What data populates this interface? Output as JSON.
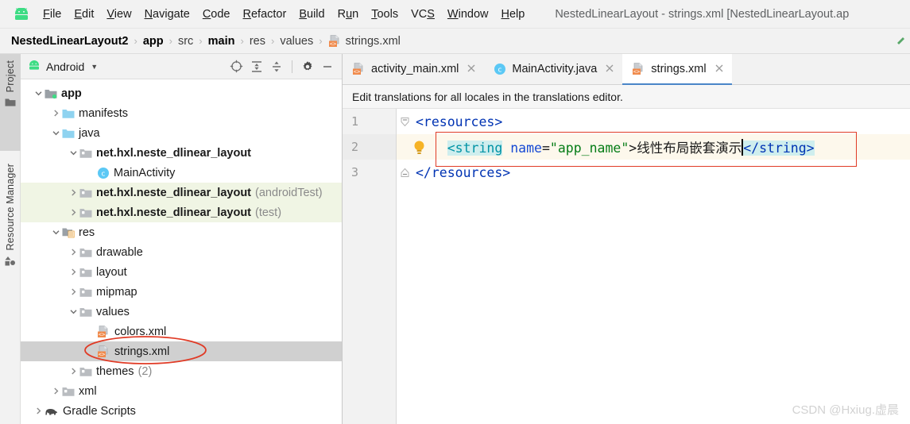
{
  "window": {
    "title": "NestedLinearLayout - strings.xml [NestedLinearLayout.ap",
    "logo_icon": "android-logo-icon"
  },
  "menubar": {
    "items": [
      {
        "label": "File",
        "mnemonic": "F"
      },
      {
        "label": "Edit",
        "mnemonic": "E"
      },
      {
        "label": "View",
        "mnemonic": "V"
      },
      {
        "label": "Navigate",
        "mnemonic": "N"
      },
      {
        "label": "Code",
        "mnemonic": "C"
      },
      {
        "label": "Refactor",
        "mnemonic": "R"
      },
      {
        "label": "Build",
        "mnemonic": "B"
      },
      {
        "label": "Run",
        "mnemonic": "u"
      },
      {
        "label": "Tools",
        "mnemonic": "T"
      },
      {
        "label": "VCS",
        "mnemonic": "S"
      },
      {
        "label": "Window",
        "mnemonic": "W"
      },
      {
        "label": "Help",
        "mnemonic": "H"
      }
    ]
  },
  "breadcrumb": {
    "items": [
      {
        "label": "NestedLinearLayout2",
        "bold": true
      },
      {
        "label": "app",
        "bold": true
      },
      {
        "label": "src",
        "bold": false
      },
      {
        "label": "main",
        "bold": true
      },
      {
        "label": "res",
        "bold": false
      },
      {
        "label": "values",
        "bold": false
      },
      {
        "label": "strings.xml",
        "bold": false,
        "icon": "xml-file-icon"
      }
    ],
    "separator": "›"
  },
  "tool_tabs": [
    {
      "label": "Project",
      "icon": "project-folder-icon",
      "active": true
    },
    {
      "label": "Resource Manager",
      "icon": "resource-manager-icon",
      "active": false
    }
  ],
  "project_panel": {
    "title": "Android",
    "title_icon": "android-head-icon",
    "dropdown_icon": "chevron-down-icon",
    "tools": [
      {
        "name": "select-opened-file-icon"
      },
      {
        "name": "expand-all-icon"
      },
      {
        "name": "collapse-all-icon"
      },
      {
        "name": "settings-gear-icon"
      },
      {
        "name": "hide-panel-icon"
      }
    ],
    "tree": [
      {
        "label": "app",
        "suffix": "",
        "depth": 0,
        "arrow": "down",
        "icon": "module-folder-icon",
        "bold": true,
        "state": "normal"
      },
      {
        "label": "manifests",
        "suffix": "",
        "depth": 1,
        "arrow": "right",
        "icon": "folder-blue-icon",
        "bold": false,
        "state": "normal"
      },
      {
        "label": "java",
        "suffix": "",
        "depth": 1,
        "arrow": "down",
        "icon": "folder-blue-icon",
        "bold": false,
        "state": "normal"
      },
      {
        "label": "net.hxl.neste_dlinear_layout",
        "suffix": "",
        "depth": 2,
        "arrow": "down",
        "icon": "package-icon",
        "bold": true,
        "state": "normal"
      },
      {
        "label": "MainActivity",
        "suffix": "",
        "depth": 3,
        "arrow": "none",
        "icon": "java-class-icon",
        "bold": false,
        "state": "normal"
      },
      {
        "label": "net.hxl.neste_dlinear_layout",
        "suffix": "(androidTest)",
        "depth": 2,
        "arrow": "right",
        "icon": "package-icon",
        "bold": true,
        "state": "test"
      },
      {
        "label": "net.hxl.neste_dlinear_layout",
        "suffix": "(test)",
        "depth": 2,
        "arrow": "right",
        "icon": "package-icon",
        "bold": true,
        "state": "test"
      },
      {
        "label": "res",
        "suffix": "",
        "depth": 1,
        "arrow": "down",
        "icon": "res-folder-icon",
        "bold": false,
        "state": "normal"
      },
      {
        "label": "drawable",
        "suffix": "",
        "depth": 2,
        "arrow": "right",
        "icon": "package-icon",
        "bold": false,
        "state": "normal"
      },
      {
        "label": "layout",
        "suffix": "",
        "depth": 2,
        "arrow": "right",
        "icon": "package-icon",
        "bold": false,
        "state": "normal"
      },
      {
        "label": "mipmap",
        "suffix": "",
        "depth": 2,
        "arrow": "right",
        "icon": "package-icon",
        "bold": false,
        "state": "normal"
      },
      {
        "label": "values",
        "suffix": "",
        "depth": 2,
        "arrow": "down",
        "icon": "package-icon",
        "bold": false,
        "state": "normal"
      },
      {
        "label": "colors.xml",
        "suffix": "",
        "depth": 3,
        "arrow": "none",
        "icon": "xml-file-icon",
        "bold": false,
        "state": "normal"
      },
      {
        "label": "strings.xml",
        "suffix": "",
        "depth": 3,
        "arrow": "none",
        "icon": "xml-file-icon",
        "bold": false,
        "state": "selected"
      },
      {
        "label": "themes",
        "suffix": "(2)",
        "depth": 2,
        "arrow": "right",
        "icon": "package-icon",
        "bold": false,
        "state": "normal"
      },
      {
        "label": "xml",
        "suffix": "",
        "depth": 1,
        "arrow": "right",
        "icon": "package-icon",
        "bold": false,
        "state": "normal"
      },
      {
        "label": "Gradle Scripts",
        "suffix": "",
        "depth": 0,
        "arrow": "right",
        "icon": "gradle-elephant-icon",
        "bold": false,
        "state": "normal"
      }
    ]
  },
  "editor": {
    "tabs": [
      {
        "label": "activity_main.xml",
        "icon": "xml-file-icon",
        "active": false,
        "close_icon": "close-icon"
      },
      {
        "label": "MainActivity.java",
        "icon": "java-class-icon",
        "active": false,
        "close_icon": "close-icon"
      },
      {
        "label": "strings.xml",
        "icon": "xml-file-icon",
        "active": true,
        "close_icon": "close-icon"
      }
    ],
    "notification": "Edit translations for all locales in the translations editor.",
    "lines": [
      {
        "number": "1",
        "fold": "collapse-down-icon",
        "highlighted": false,
        "bulb": false,
        "tokens": [
          {
            "text": "<resources>",
            "style": "kw"
          }
        ]
      },
      {
        "number": "2",
        "fold": "none",
        "highlighted": true,
        "bulb": true,
        "tokens": [
          {
            "text": "    ",
            "style": "plain"
          },
          {
            "text": "<string",
            "style": "tagname-hl"
          },
          {
            "text": " ",
            "style": "plain"
          },
          {
            "text": "name",
            "style": "attr"
          },
          {
            "text": "=",
            "style": "plain"
          },
          {
            "text": "\"app_name\"",
            "style": "attrval"
          },
          {
            "text": ">",
            "style": "plain"
          },
          {
            "text": "线性布局嵌套演示",
            "style": "plain"
          },
          {
            "text": "CARET",
            "style": "caret"
          },
          {
            "text": "</string>",
            "style": "kw-hl"
          }
        ]
      },
      {
        "number": "3",
        "fold": "collapse-up-icon",
        "highlighted": false,
        "bulb": false,
        "tokens": [
          {
            "text": "</resources>",
            "style": "kw"
          }
        ]
      }
    ],
    "bulb_icon": "intention-bulb-icon"
  },
  "annotations": {
    "rect_color": "#e03b26",
    "ellipse_color": "#e03b26"
  },
  "watermark": "CSDN @Hxiug.虚晨",
  "colors": {
    "accent": "#4a86c8",
    "test_row_bg": "#f0f5e4",
    "selected_row_bg": "#d0d0d0",
    "code_highlight_bg": "#fdf8ec",
    "tag_highlight_bg": "#cfeeee"
  }
}
